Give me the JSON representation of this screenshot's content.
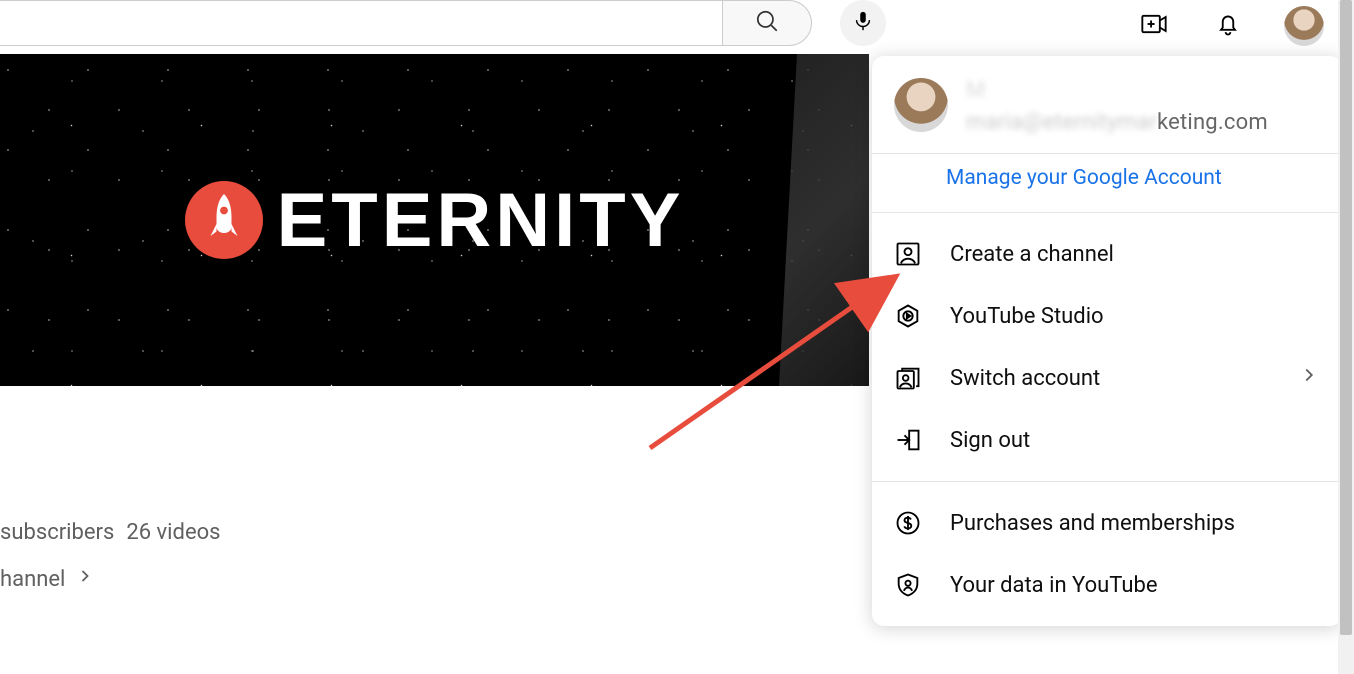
{
  "search": {
    "placeholder": ""
  },
  "banner": {
    "brand": "ETERNITY"
  },
  "channel": {
    "subscribers_partial": "subscribers",
    "videos_count": "26 videos",
    "channel_link_partial": "hannel"
  },
  "account_menu": {
    "name": "M",
    "email_suffix": "keting.com",
    "manage_label": "Manage your Google Account",
    "section1": [
      {
        "icon": "person-box-icon",
        "label": "Create a channel",
        "has_chevron": false
      },
      {
        "icon": "studio-icon",
        "label": "YouTube Studio",
        "has_chevron": false
      },
      {
        "icon": "switch-account-icon",
        "label": "Switch account",
        "has_chevron": true
      },
      {
        "icon": "sign-out-icon",
        "label": "Sign out",
        "has_chevron": false
      }
    ],
    "section2": [
      {
        "icon": "dollar-circle-icon",
        "label": "Purchases and memberships",
        "has_chevron": false
      },
      {
        "icon": "data-shield-icon",
        "label": "Your data in YouTube",
        "has_chevron": false
      }
    ]
  }
}
